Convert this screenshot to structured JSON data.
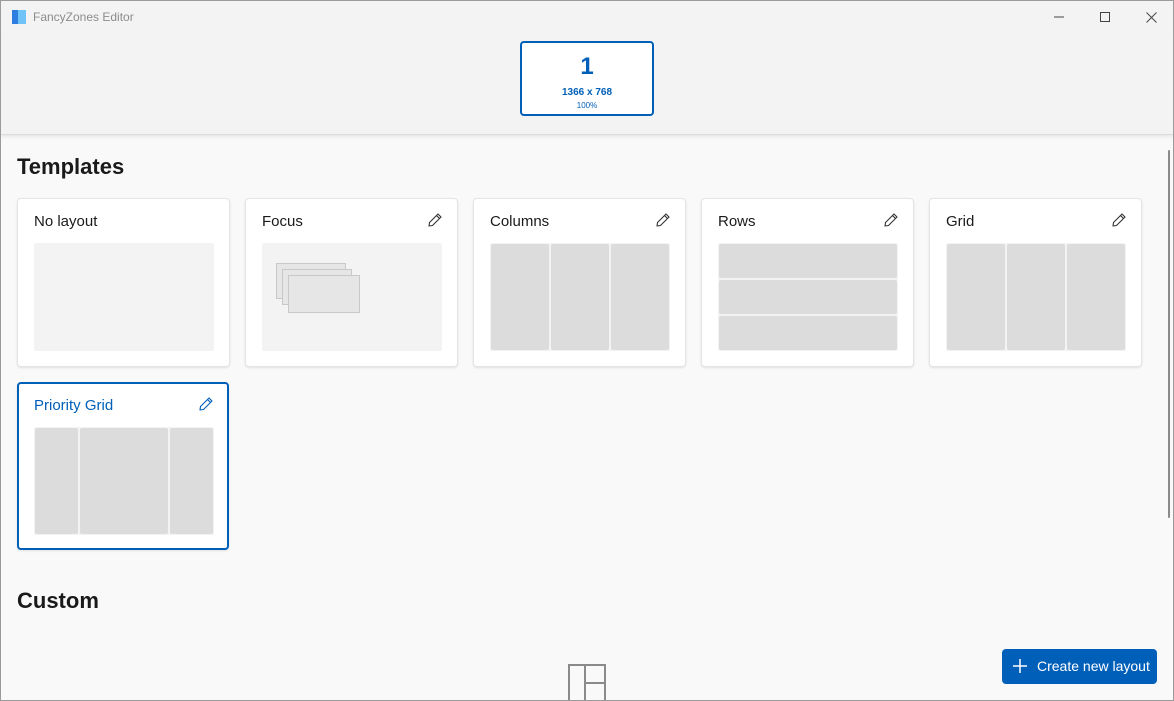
{
  "window": {
    "title": "FancyZones Editor",
    "controls": {
      "minimize": "minimize-icon",
      "maximize": "maximize-icon",
      "close": "close-icon"
    }
  },
  "monitor": {
    "number": "1",
    "resolution": "1366 x 768",
    "scale": "100%"
  },
  "sections": {
    "templates": "Templates",
    "custom": "Custom"
  },
  "templates": [
    {
      "title": "No layout",
      "editable": false,
      "preview": "blank"
    },
    {
      "title": "Focus",
      "editable": true,
      "preview": "focus"
    },
    {
      "title": "Columns",
      "editable": true,
      "preview": "columns",
      "zones": 3
    },
    {
      "title": "Rows",
      "editable": true,
      "preview": "rows",
      "zones": 3
    },
    {
      "title": "Grid",
      "editable": true,
      "preview": "grid",
      "zones": 3
    },
    {
      "title": "Priority Grid",
      "editable": true,
      "preview": "priority-grid",
      "zones": 3,
      "selected": true
    }
  ],
  "actions": {
    "create_new_layout": "Create new layout"
  },
  "colors": {
    "accent": "#005fb8",
    "zone": "#dcdcdc",
    "preview_bg": "#f3f3f3",
    "page_bg": "#f9f9f9"
  }
}
